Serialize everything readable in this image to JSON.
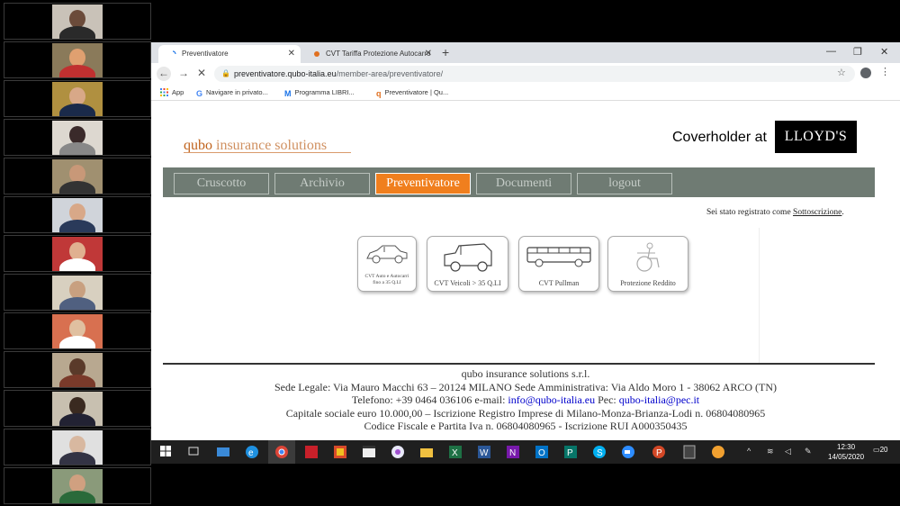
{
  "browser": {
    "tabs": [
      {
        "label": "Preventivatore",
        "close": "✕"
      },
      {
        "label": "CVT Tariffa Protezione Autocarro",
        "close": "✕"
      }
    ],
    "new_tab": "+",
    "window_controls": [
      "—",
      "❐",
      "✕"
    ],
    "url_domain": "preventivatore.qubo-italia.eu",
    "url_path": "/member-area/preventivatore/",
    "bookmarks": [
      "App",
      "Navigare in privato...",
      "Programma LIBRI...",
      "Preventivatore | Qu..."
    ]
  },
  "site": {
    "logo_brand": "qubo",
    "logo_rest": " insurance solutions",
    "coverholder": "Coverholder at",
    "lloyds": "LLOYD'S",
    "nav": [
      "Cruscotto",
      "Archivio",
      "Preventivatore",
      "Documenti",
      "logout"
    ],
    "active_nav": "Preventivatore",
    "reg_prefix": "Sei stato registrato come ",
    "reg_link": "Sottoscrizione",
    "reg_suffix": ".",
    "products": [
      {
        "label_line1": "CVT Auto e Autocarri",
        "label_line2": "fino a 35 Q.LI"
      },
      {
        "label": "CVT Veicoli > 35 Q.LI"
      },
      {
        "label": "CVT Pullman"
      },
      {
        "label": "Protezione Reddito"
      }
    ],
    "footer": {
      "line1": "qubo insurance solutions s.r.l.",
      "line2": "Sede Legale: Via Mauro Macchi 63 – 20124 MILANO Sede Amministrativa: Via Aldo Moro 1 - 38062 ARCO (TN)",
      "line3_prefix": "Telefono: +39 0464 036106 e-mail: ",
      "email": "info@qubo-italia.eu",
      "pec_label": " Pec: ",
      "pec": "qubo-italia@pec.it",
      "line4": "Capitale sociale euro 10.000,00 – Iscrizione Registro Imprese di Milano-Monza-Brianza-Lodi n. 06804080965",
      "line5": "Codice Fiscale e Partita Iva n. 06804080965 - Iscrizione RUI A000350435"
    }
  },
  "taskbar": {
    "time": "12:30",
    "date": "14/05/2020",
    "notifications": "20"
  },
  "colors": {
    "accent_orange": "#f07f1e",
    "nav_bar": "#6f7b73",
    "brand_orange": "#c0621b"
  }
}
